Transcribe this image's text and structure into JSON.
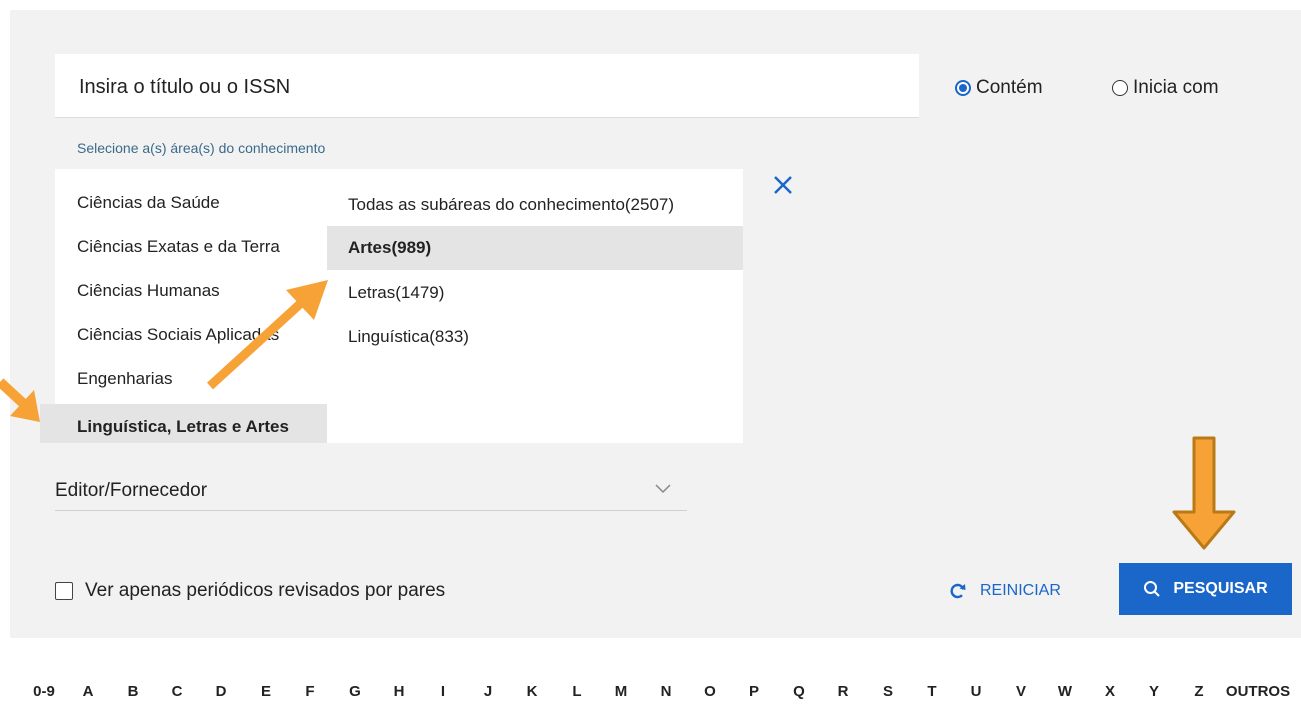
{
  "search": {
    "placeholder": "Insira o título ou o ISSN"
  },
  "match_mode": {
    "options": [
      {
        "label": "Contém",
        "checked": true
      },
      {
        "label": "Inicia com",
        "checked": false
      }
    ]
  },
  "areas": {
    "label": "Selecione a(s) área(s) do conhecimento",
    "main": [
      {
        "label": "Ciências da Saúde",
        "selected": false
      },
      {
        "label": "Ciências Exatas e da Terra",
        "selected": false
      },
      {
        "label": "Ciências Humanas",
        "selected": false
      },
      {
        "label": "Ciências Sociais Aplicadas",
        "selected": false
      },
      {
        "label": "Engenharias",
        "selected": false
      },
      {
        "label": "Linguística, Letras e Artes",
        "selected": true
      }
    ],
    "sub": [
      {
        "label": "Todas as subáreas do conhecimento(2507)",
        "selected": false
      },
      {
        "label": "Artes(989)",
        "selected": true
      },
      {
        "label": "Letras(1479)",
        "selected": false
      },
      {
        "label": "Linguística(833)",
        "selected": false
      }
    ]
  },
  "editor": {
    "label": "Editor/Fornecedor"
  },
  "peer_review": {
    "label": "Ver apenas periódicos revisados por pares",
    "checked": false
  },
  "actions": {
    "reset_label": "REINICIAR",
    "search_label": "PESQUISAR"
  },
  "alphabet": [
    "0-9",
    "A",
    "B",
    "C",
    "D",
    "E",
    "F",
    "G",
    "H",
    "I",
    "J",
    "K",
    "L",
    "M",
    "N",
    "O",
    "P",
    "Q",
    "R",
    "S",
    "T",
    "U",
    "V",
    "W",
    "X",
    "Y",
    "Z",
    "OUTROS"
  ],
  "colors": {
    "accent": "#1a66c9",
    "annotation_arrow": "#f7a236",
    "selected_bg": "#e4e4e4",
    "panel_bg": "#f2f2f2"
  },
  "icons": {
    "close": "close-icon",
    "chevron": "chevron-down-icon",
    "reset": "refresh-icon",
    "search": "search-icon"
  }
}
